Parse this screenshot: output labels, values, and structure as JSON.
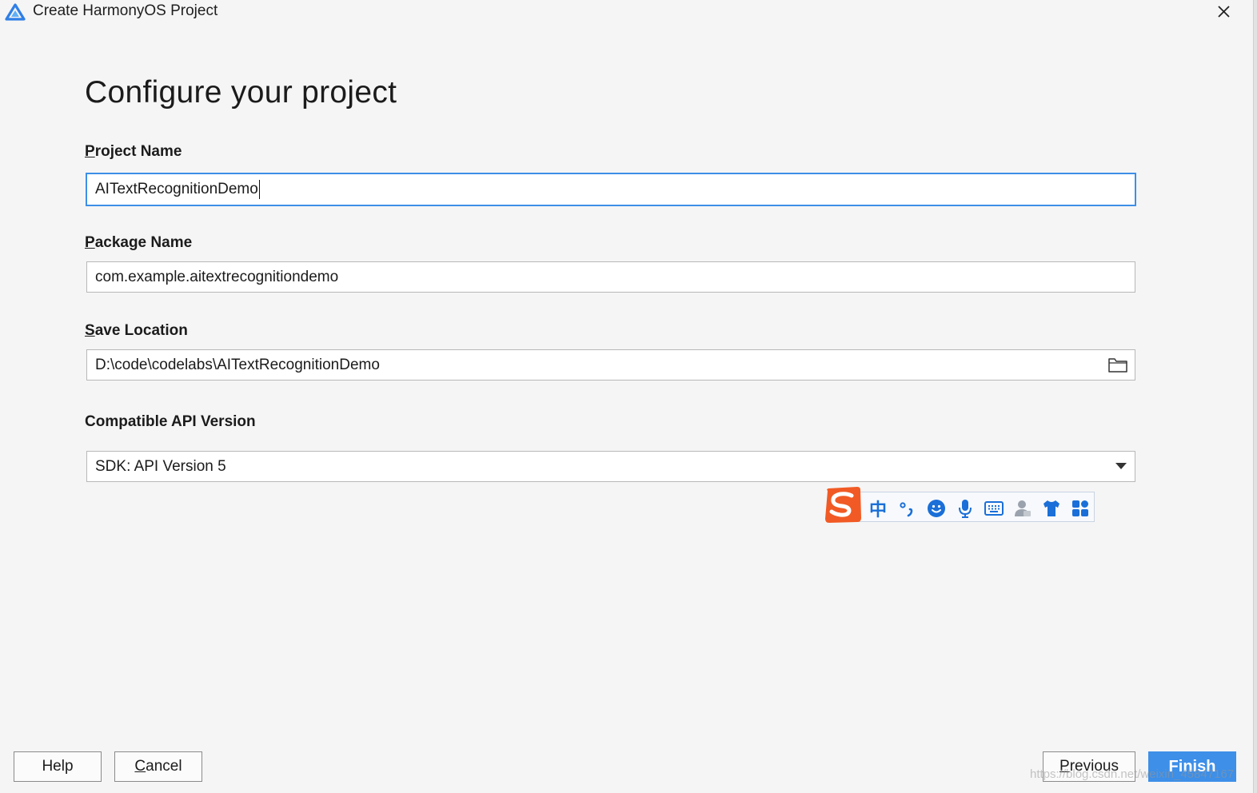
{
  "window": {
    "title": "Create HarmonyOS Project",
    "close_icon": "close-icon",
    "logo_icon": "harmonyos-logo-icon"
  },
  "page": {
    "heading": "Configure your project"
  },
  "form": {
    "project_name": {
      "label_mnemonic": "P",
      "label_rest": "roject Name",
      "value": "AITextRecognitionDemo"
    },
    "package_name": {
      "label_mnemonic": "P",
      "label_rest": "ackage Name",
      "value": "com.example.aitextrecognitiondemo"
    },
    "save_location": {
      "label_mnemonic": "S",
      "label_rest": "ave Location",
      "value": "D:\\code\\codelabs\\AITextRecognitionDemo",
      "browse_icon": "folder-icon"
    },
    "api_version": {
      "label": "Compatible API Version",
      "selected": "SDK: API Version 5",
      "arrow_icon": "chevron-down-icon"
    }
  },
  "ime_toolbar": {
    "logo_icon": "sogou-logo-icon",
    "mode_char": "中",
    "items": [
      "punctuation-icon",
      "emoji-icon",
      "microphone-icon",
      "keyboard-icon",
      "user-icon",
      "skin-shirt-icon",
      "toolbox-icon"
    ],
    "accent_color": "#1a6fd8",
    "logo_color": "#f15a24"
  },
  "buttons": {
    "help": "Help",
    "cancel_mnemonic": "C",
    "cancel_rest": "ancel",
    "previous_mnemonic": "P",
    "previous_rest": "revious",
    "finish": "Finish"
  },
  "watermark": "https://blog.csdn.net/weixin_45847167",
  "colors": {
    "accent": "#3d8fe8",
    "background": "#f5f5f5"
  }
}
